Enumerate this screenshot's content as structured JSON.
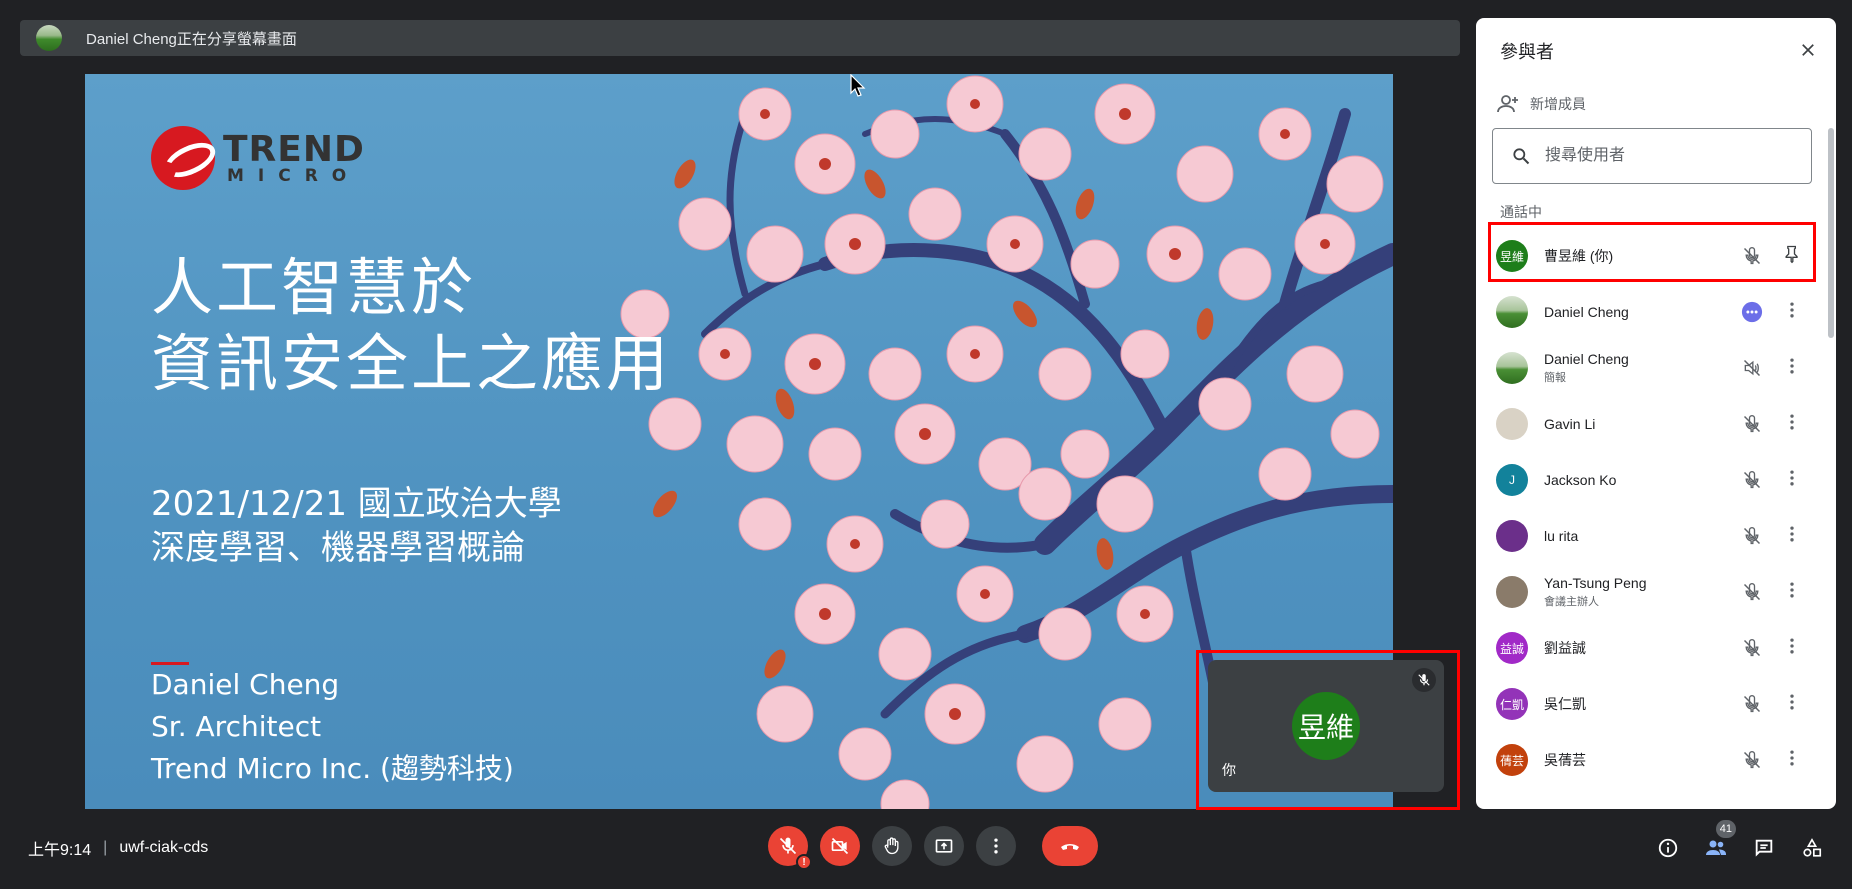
{
  "share_banner": {
    "text": "Daniel Cheng正在分享螢幕畫面"
  },
  "slide": {
    "logo_trend": "TREND",
    "logo_micro": "MICRO",
    "title_line1": "人工智慧於",
    "title_line2": "資訊安全上之應用",
    "subtitle_line1": "2021/12/21 國立政治大學",
    "subtitle_line2": "深度學習、機器學習概論",
    "author_name": "Daniel Cheng",
    "author_role": "Sr. Architect",
    "author_company": "Trend Micro Inc. (趨勢科技)"
  },
  "self_tile": {
    "avatar_text": "昱維",
    "label": "你"
  },
  "panel": {
    "title": "參與者",
    "add_member": "新增成員",
    "search_placeholder": "搜尋使用者",
    "section": "通話中",
    "participants": [
      {
        "name": "曹昱維 (你)",
        "role": "",
        "avatar_text": "昱維",
        "avatar_color": "#1e7e1a",
        "mic": "muted",
        "action": "pin"
      },
      {
        "name": "Daniel Cheng",
        "role": "",
        "avatar_text": "",
        "avatar_color": "landscape",
        "mic": "speaking",
        "action": "more"
      },
      {
        "name": "Daniel Cheng",
        "role": "簡報",
        "avatar_text": "",
        "avatar_color": "landscape",
        "mic": "audio-off",
        "action": "more"
      },
      {
        "name": "Gavin Li",
        "role": "",
        "avatar_text": "",
        "avatar_color": "#d9d2c5",
        "mic": "muted",
        "action": "more"
      },
      {
        "name": "Jackson Ko",
        "role": "",
        "avatar_text": "J",
        "avatar_color": "#12829b",
        "mic": "muted",
        "action": "more"
      },
      {
        "name": "lu rita",
        "role": "",
        "avatar_text": "",
        "avatar_color": "#6b2f8a",
        "mic": "muted",
        "action": "more"
      },
      {
        "name": "Yan-Tsung Peng",
        "role": "會議主辦人",
        "avatar_text": "",
        "avatar_color": "#8a7b6a",
        "mic": "muted",
        "action": "more"
      },
      {
        "name": "劉益誠",
        "role": "",
        "avatar_text": "益誠",
        "avatar_color": "#a129c7",
        "mic": "muted",
        "action": "more"
      },
      {
        "name": "吳仁凱",
        "role": "",
        "avatar_text": "仁凱",
        "avatar_color": "#9333b8",
        "mic": "muted",
        "action": "more"
      },
      {
        "name": "吳蒨芸",
        "role": "",
        "avatar_text": "蒨芸",
        "avatar_color": "#c2410c",
        "mic": "muted",
        "action": "more"
      }
    ]
  },
  "bottom": {
    "time": "上午9:14",
    "separator": "|",
    "meeting_code": "uwf-ciak-cds",
    "participants_count": "41"
  }
}
